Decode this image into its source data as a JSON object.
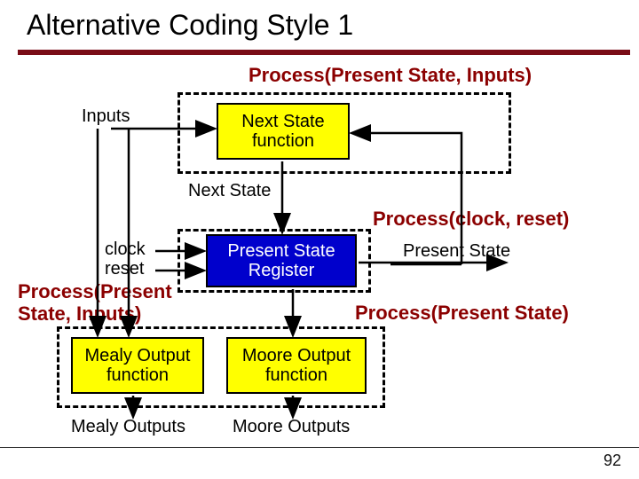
{
  "title": "Alternative Coding Style 1",
  "page_number": "92",
  "labels": {
    "process_ps_inputs_top": "Process(Present State, Inputs)",
    "process_clock_reset": "Process(clock, reset)",
    "process_present_state": "Process(Present State)",
    "process_ps_inputs_left": "Process(Present\nState, Inputs)",
    "inputs": "Inputs",
    "clock": "clock",
    "reset": "reset",
    "next_state": "Next State",
    "present_state": "Present State",
    "mealy_outputs": "Mealy Outputs",
    "moore_outputs": "Moore Outputs"
  },
  "boxes": {
    "next_state_function": "Next State\nfunction",
    "present_state_register": "Present State\nRegister",
    "mealy_output_function": "Mealy Output\nfunction",
    "moore_output_function": "Moore Output\nfunction"
  }
}
